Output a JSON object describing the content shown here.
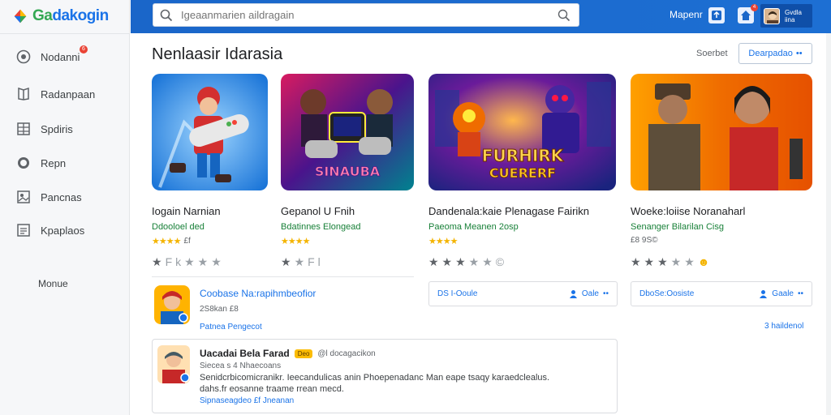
{
  "app": {
    "name_part1": "Ga",
    "name_part2": "dakogin"
  },
  "search": {
    "placeholder": "Igeaanmarien aildragain"
  },
  "topbar": {
    "link": "Mapenr",
    "notification_count": "4",
    "profile_line1": "Gvdla",
    "profile_line2": "iina"
  },
  "sidebar": {
    "items": [
      {
        "label": "Nodanni",
        "icon": "home-icon",
        "badge": "6"
      },
      {
        "label": "Radanpaan",
        "icon": "book-icon"
      },
      {
        "label": "Spdiris",
        "icon": "grid-icon"
      },
      {
        "label": "Repn",
        "icon": "circle-icon"
      },
      {
        "label": "Pancnas",
        "icon": "image-icon"
      },
      {
        "label": "Kpaplaos",
        "icon": "list-icon"
      }
    ],
    "more_label": "Monue"
  },
  "section": {
    "title": "Nenlaasir Idarasia",
    "see_label": "Soerbet",
    "more_button": "Dearpadao"
  },
  "cards": [
    {
      "title": "Iogain Narnian",
      "subtitle": "Ddooloel ded",
      "meta": "£f",
      "stars": "★★★★",
      "art_text": "",
      "rating_label": "Fk"
    },
    {
      "title": "Gepanol U Fnih",
      "subtitle": "Bdatinnes Elongead",
      "meta": "",
      "stars": "★★★★",
      "art_text": "SINAUBA",
      "rating_label": "Fl"
    },
    {
      "title": "Dandenala:kaie Plenagase Fairikn",
      "subtitle": "Paeoma Meanen 2osp",
      "meta": "",
      "stars": "★★★★",
      "art_text_1": "FURHIRK",
      "art_text_2": "CUERERF",
      "rating_label": "©"
    },
    {
      "title": "Woeke:loiise Noranaharl",
      "subtitle": "Senanger Bilarilan Cisg",
      "meta": "£8 9S©",
      "stars": "",
      "art_text": "",
      "rating_label": "☻"
    }
  ],
  "developer": {
    "name": "Coobase Na:rapihmbeofior",
    "stat": "2S8kan £8",
    "link": "Patnea Pengecot"
  },
  "review_boxes": [
    {
      "left": "DS I-Ooule",
      "right": "Oale"
    },
    {
      "left": "DboSe:Oosiste",
      "right": "Gaale"
    }
  ],
  "more_reviews": "3 haildenol",
  "comment": {
    "name": "Uacadai Bela Farad",
    "badge": "Deo",
    "handle": "@l docagacikon",
    "date": "Siecea s 4 Nhaecoans",
    "body": "Senidcrbicomicranikr. Ieecandulicas anin Phoepenadanc Man eape tsaqy karaedclealus.",
    "body2": "dahs.fr eosanne traame rrean mecd.",
    "footer": "Sipnaseagdeo £f Jneanan"
  },
  "colors": {
    "brand_blue": "#1a66c9",
    "accent_green": "#34a853",
    "star_gold": "#f4b400",
    "badge_red": "#ea4335"
  }
}
